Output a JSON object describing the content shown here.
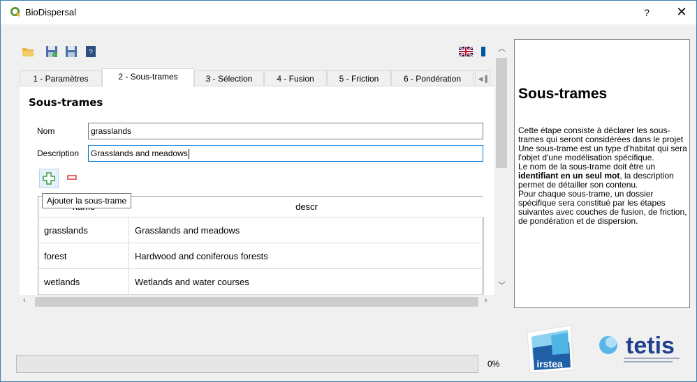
{
  "window": {
    "title": "BioDispersal",
    "help_label": "?",
    "close_label": "✕"
  },
  "toolbar": {
    "icons": [
      "open-folder-icon",
      "save-as-icon",
      "save-icon",
      "help-book-icon"
    ],
    "language_flags": [
      "uk-flag-icon",
      "fr-flag-icon"
    ]
  },
  "tabs": [
    {
      "label": "1 - Paramètres"
    },
    {
      "label": "2 - Sous-trames",
      "active": true
    },
    {
      "label": "3 - Sélection"
    },
    {
      "label": "4 - Fusion"
    },
    {
      "label": "5 - Friction"
    },
    {
      "label": "6 - Pondération"
    }
  ],
  "main": {
    "section_title": "Sous-trames",
    "name_label": "Nom",
    "name_value": "grasslands",
    "description_label": "Description",
    "description_value": "Grasslands and meadows",
    "add_tooltip": "Ajouter la sous-trame",
    "table": {
      "columns": [
        "name",
        "descr"
      ],
      "rows": [
        {
          "name": "grasslands",
          "descr": "Grasslands and meadows"
        },
        {
          "name": "forest",
          "descr": "Hardwood and coniferous forests"
        },
        {
          "name": "wetlands",
          "descr": "Wetlands and water courses"
        }
      ]
    }
  },
  "help_panel": {
    "title": "Sous-trames",
    "p1": " Cette étape consiste à déclarer les sous-trames qui seront considérées dans le projet",
    "p2": " Une sous-trame est un type d'habitat qui sera l'objet d'une modélisation spécifique.",
    "p3_before": " Le nom de la sous-trame doit être un ",
    "p3_bold": "identifiant en un seul mot",
    "p3_after": ", la description permet de détailler son contenu.",
    "p4": "  Pour chaque sous-trame, un dossier spécifique sera constitué par les étapes suivantes avec couches de fusion, de friction, de pondération et de dispersion."
  },
  "progress": {
    "value": 0,
    "label": "0%"
  },
  "logos": {
    "irstea": "irstea",
    "tetis": "tetis"
  },
  "colors": {
    "qgis_green": "#589632",
    "focus_blue": "#0078d7",
    "tetis_blue": "#1f3f8f"
  }
}
